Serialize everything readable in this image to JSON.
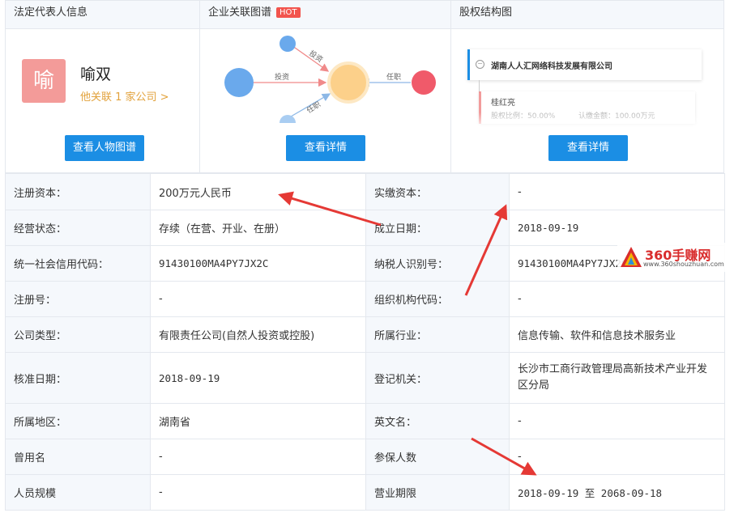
{
  "cards": {
    "legal_rep": {
      "title": "法定代表人信息",
      "avatar_char": "喻",
      "name": "喻双",
      "link": "他关联 1 家公司 >",
      "button": "查看人物图谱"
    },
    "graph": {
      "title": "企业关联图谱",
      "badge": "HOT",
      "edge_invest_1": "投资",
      "edge_invest_2": "投资",
      "edge_role_1": "任职",
      "edge_role_2": "任职",
      "button": "查看详情"
    },
    "equity": {
      "title": "股权结构图",
      "company": "湖南人人汇网络科技发展有限公司",
      "holder": "桂红亮",
      "holder_ratio": "股权比例：50.00%",
      "holder_amount": "认缴金额：100.00万元",
      "button": "查看详情"
    }
  },
  "table": {
    "rows": [
      {
        "l1": "注册资本：",
        "v1": "200万元人民币",
        "l2": "实缴资本：",
        "v2": "-"
      },
      {
        "l1": "经营状态：",
        "v1": "存续（在营、开业、在册）",
        "l2": "成立日期：",
        "v2": "2018-09-19"
      },
      {
        "l1": "统一社会信用代码：",
        "v1": "91430100MA4PY7JX2C",
        "l2": "纳税人识别号：",
        "v2": "91430100MA4PY7JX2C"
      },
      {
        "l1": "注册号：",
        "v1": "-",
        "l2": "组织机构代码：",
        "v2": "-"
      },
      {
        "l1": "公司类型：",
        "v1": "有限责任公司(自然人投资或控股)",
        "l2": "所属行业：",
        "v2": "信息传输、软件和信息技术服务业"
      },
      {
        "l1": "核准日期：",
        "v1": "2018-09-19",
        "l2": "登记机关：",
        "v2": "长沙市工商行政管理局高新技术产业开发区分局"
      },
      {
        "l1": "所属地区：",
        "v1": "湖南省",
        "l2": "英文名：",
        "v2": "-"
      },
      {
        "l1": "曾用名",
        "v1": "-",
        "l2": "参保人数",
        "v2": "-"
      },
      {
        "l1": "人员规模",
        "v1": "-",
        "l2": "营业期限",
        "v2": "2018-09-19 至 2068-09-18"
      }
    ]
  },
  "watermark": {
    "title": "360手赚网",
    "url": "www.360shouzhuan.com"
  },
  "colors": {
    "button_blue": "#1b8ee4",
    "hot_red": "#f2544d",
    "arrow_red": "#e53935",
    "link_orange": "#e2a23c",
    "label_bg": "#f5f8fc"
  }
}
